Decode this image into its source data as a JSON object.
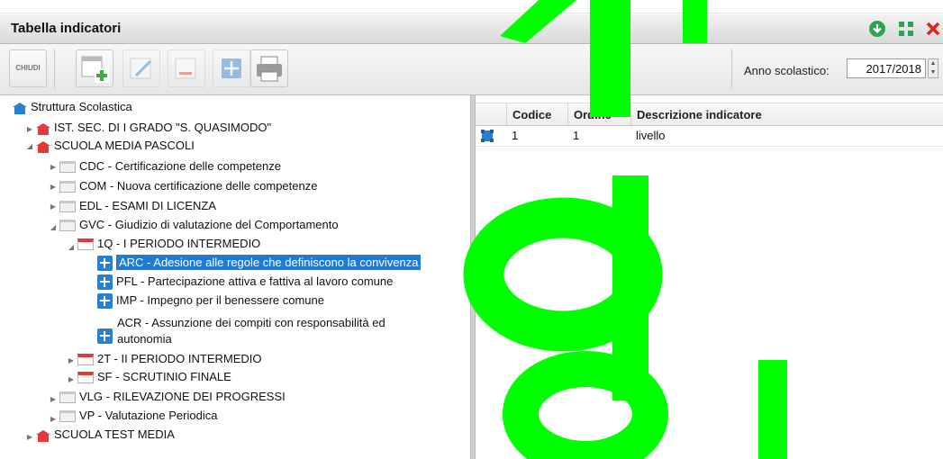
{
  "window": {
    "title": "Tabella indicatori"
  },
  "toolbar": {
    "close_label": "CHIUDI",
    "year_label": "Anno scolastico:",
    "year_value": "2017/2018"
  },
  "tree": {
    "root": "Struttura Scolastica",
    "n1": "IST. SEC. DI I GRADO \"S. QUASIMODO\"",
    "n2": "SCUOLA MEDIA PASCOLI",
    "n3": "CDC - Certificazione delle competenze",
    "n4": "COM - Nuova certificazione delle competenze",
    "n5": "EDL - ESAMI DI LICENZA",
    "n6": "GVC - Giudizio di valutazione del Comportamento",
    "n7": "1Q - I PERIODO INTERMEDIO",
    "n8": "ARC - Adesione alle regole che definiscono la convivenza",
    "n9": "PFL - Partecipazione attiva e fattiva al lavoro comune",
    "n10": "IMP - Impegno per il benessere comune",
    "n11a": "ACR - Assunzione dei compiti con responsabilità ed",
    "n11b": "autonomia",
    "n12": "2T - II PERIODO INTERMEDIO",
    "n13": "SF - SCRUTINIO FINALE",
    "n14": "VLG - RILEVAZIONE DEI PROGRESSI",
    "n15": "VP - Valutazione Periodica",
    "n16": "SCUOLA TEST MEDIA"
  },
  "table": {
    "headers": {
      "codice": "Codice",
      "ordine": "Ordine",
      "descrizione": "Descrizione indicatore"
    },
    "row1": {
      "codice": "1",
      "ordine": "1",
      "descrizione": "livello"
    }
  },
  "colors": {
    "overlay_green": "#00ff00",
    "selection": "#1e7bd6",
    "titlebar_close": "#e0241b",
    "titlebar_ok": "#2ea44f"
  }
}
